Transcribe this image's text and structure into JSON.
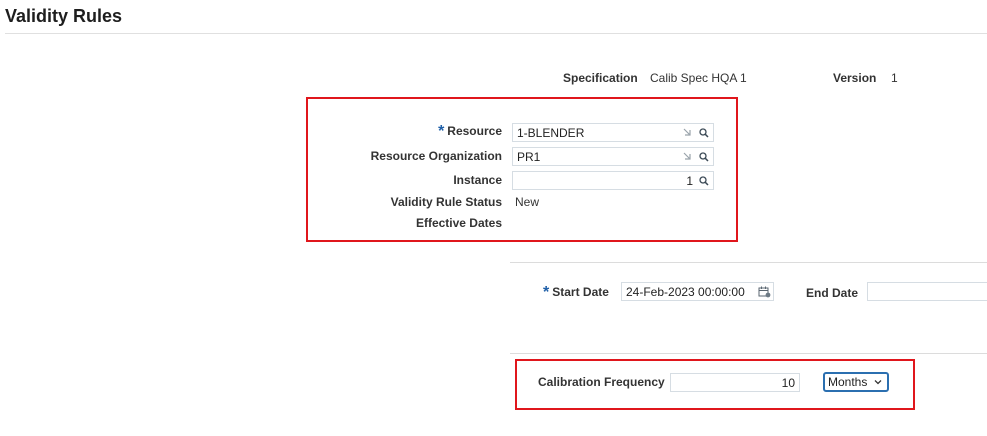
{
  "page": {
    "title": "Validity Rules"
  },
  "header": {
    "specification_label": "Specification",
    "specification_value": "Calib Spec HQA 1",
    "version_label": "Version",
    "version_value": "1"
  },
  "resource_section": {
    "resource_label": "Resource",
    "resource_value": "1-BLENDER",
    "resource_org_label": "Resource Organization",
    "resource_org_value": "PR1",
    "instance_label": "Instance",
    "instance_value": "1",
    "status_label": "Validity Rule Status",
    "status_value": "New",
    "effective_dates_label": "Effective Dates",
    "required_marker": "*"
  },
  "dates_section": {
    "start_date_label": "Start Date",
    "start_date_value": "24-Feb-2023 00:00:00",
    "end_date_label": "End Date",
    "end_date_value": "",
    "required_marker": "*"
  },
  "calibration": {
    "frequency_label": "Calibration Frequency",
    "frequency_value": "10",
    "unit_selected": "Months"
  },
  "colors": {
    "highlight_border": "#e0161c",
    "required_star": "#1f5fa8",
    "select_border": "#2b6fb0"
  }
}
